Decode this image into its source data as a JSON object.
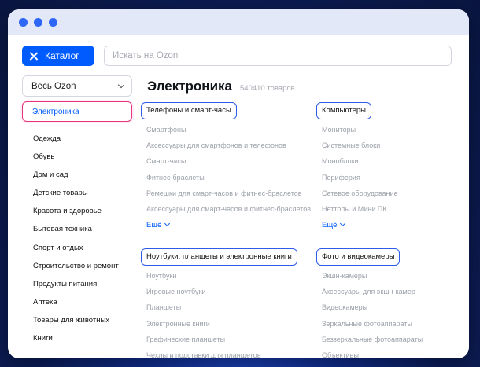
{
  "catalog_button": {
    "label": "Каталог",
    "icon": "close-icon"
  },
  "search": {
    "placeholder": "Искать на Ozon"
  },
  "sidebar": {
    "select_value": "Весь Ozon",
    "active": "Электроника",
    "items": [
      "Одежда",
      "Обувь",
      "Дом и сад",
      "Детские товары",
      "Красота и здоровье",
      "Бытовая техника",
      "Спорт и отдых",
      "Строительство и ремонт",
      "Продукты питания",
      "Аптека",
      "Товары для животных",
      "Книги"
    ]
  },
  "main": {
    "title": "Электроника",
    "count": "540410 товаров",
    "more_label": "Ещё",
    "groups": {
      "phones": {
        "title": "Телефоны и смарт-часы",
        "items": [
          "Смартфоны",
          "Аксессуары для смартфонов и телефонов",
          "Смарт-часы",
          "Фитнес-браслеты",
          "Ремешки для смарт-часов и фитнес-браслетов",
          "Аксессуары для смарт-часов и фитнес-браслетов"
        ]
      },
      "computers": {
        "title": "Компьютеры",
        "items": [
          "Мониторы",
          "Системные блоки",
          "Моноблоки",
          "Периферия",
          "Сетевое оборудование",
          "Неттопы и Мини ПК"
        ]
      },
      "laptops": {
        "title": "Ноутбуки, планшеты и электронные книги",
        "items": [
          "Ноутбуки",
          "Игровые ноутбуки",
          "Планшеты",
          "Электронные книги",
          "Графические планшеты",
          "Чехлы и подставки для планшетов"
        ]
      },
      "photo": {
        "title": "Фото и видеокамеры",
        "items": [
          "Экшн-камеры",
          "Аксессуары для экшн-камер",
          "Видеокамеры",
          "Зеркальные фотоаппараты",
          "Беззеркальные фотоаппараты",
          "Объективы"
        ]
      }
    }
  },
  "colors": {
    "accent": "#005bff",
    "active_border": "#e8347a",
    "group_border": "#2e5be8",
    "muted_text": "#9ca1a9",
    "titlebar": "#e3e8f9"
  }
}
